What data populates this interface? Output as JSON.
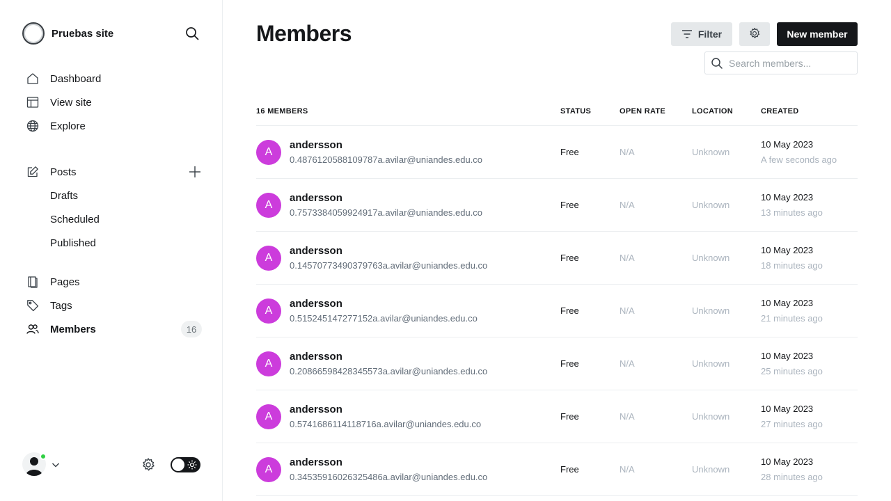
{
  "sidebar": {
    "site_name": "Pruebas site",
    "nav": {
      "dashboard": "Dashboard",
      "view_site": "View site",
      "explore": "Explore",
      "posts": "Posts",
      "drafts": "Drafts",
      "scheduled": "Scheduled",
      "published": "Published",
      "pages": "Pages",
      "tags": "Tags",
      "members": "Members",
      "members_count": "16"
    },
    "status_color": "#30cf43"
  },
  "header": {
    "title": "Members",
    "filter_label": "Filter",
    "new_member_label": "New member",
    "search_placeholder": "Search members..."
  },
  "table": {
    "count_label": "16 MEMBERS",
    "columns": {
      "status": "STATUS",
      "open_rate": "OPEN RATE",
      "location": "LOCATION",
      "created": "CREATED"
    },
    "rows": [
      {
        "initial": "A",
        "name": "andersson",
        "email": "0.4876120588109787a.avilar@uniandes.edu.co",
        "status": "Free",
        "open_rate": "N/A",
        "location": "Unknown",
        "created": "10 May 2023",
        "ago": "A few seconds ago"
      },
      {
        "initial": "A",
        "name": "andersson",
        "email": "0.7573384059924917a.avilar@uniandes.edu.co",
        "status": "Free",
        "open_rate": "N/A",
        "location": "Unknown",
        "created": "10 May 2023",
        "ago": "13 minutes ago"
      },
      {
        "initial": "A",
        "name": "andersson",
        "email": "0.14570773490379763a.avilar@uniandes.edu.co",
        "status": "Free",
        "open_rate": "N/A",
        "location": "Unknown",
        "created": "10 May 2023",
        "ago": "18 minutes ago"
      },
      {
        "initial": "A",
        "name": "andersson",
        "email": "0.515245147277152a.avilar@uniandes.edu.co",
        "status": "Free",
        "open_rate": "N/A",
        "location": "Unknown",
        "created": "10 May 2023",
        "ago": "21 minutes ago"
      },
      {
        "initial": "A",
        "name": "andersson",
        "email": "0.20866598428345573a.avilar@uniandes.edu.co",
        "status": "Free",
        "open_rate": "N/A",
        "location": "Unknown",
        "created": "10 May 2023",
        "ago": "25 minutes ago"
      },
      {
        "initial": "A",
        "name": "andersson",
        "email": "0.5741686114118716a.avilar@uniandes.edu.co",
        "status": "Free",
        "open_rate": "N/A",
        "location": "Unknown",
        "created": "10 May 2023",
        "ago": "27 minutes ago"
      },
      {
        "initial": "A",
        "name": "andersson",
        "email": "0.34535916026325486a.avilar@uniandes.edu.co",
        "status": "Free",
        "open_rate": "N/A",
        "location": "Unknown",
        "created": "10 May 2023",
        "ago": "28 minutes ago"
      }
    ]
  },
  "colors": {
    "avatar": "#cc3cdc",
    "primary_button": "#15171a",
    "muted_text": "#abb4be"
  },
  "icons": {
    "brand": "site-logo-icon",
    "search": "search-icon",
    "dashboard": "home-icon",
    "view_site": "browser-layout-icon",
    "explore": "globe-icon",
    "posts": "pencil-square-icon",
    "add": "plus-icon",
    "pages": "pages-icon",
    "tags": "tag-icon",
    "members": "users-icon",
    "filter": "filter-icon",
    "settings": "gear-icon",
    "user": "user-avatar-icon",
    "chevron": "chevron-down-icon",
    "theme": "sun-icon"
  }
}
